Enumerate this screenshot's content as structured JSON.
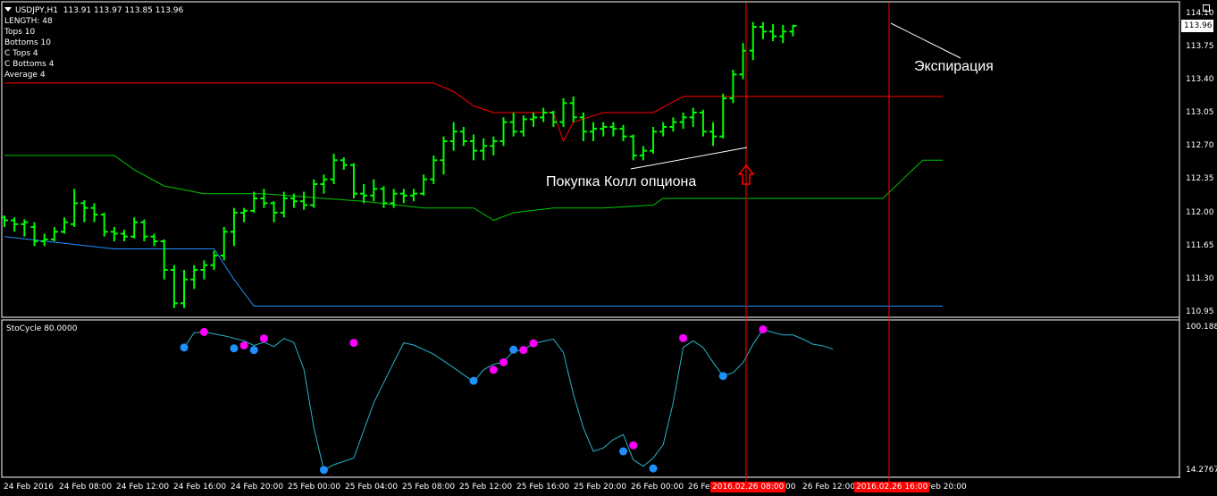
{
  "header": {
    "symbol": "USDJPY,H1",
    "ohlc": "113.91 113.97 113.85 113.96",
    "params": [
      "LENGTH: 48",
      "Tops 10",
      "Bottoms 10",
      "C Tops 4",
      "C Bottoms 4",
      "Average 4"
    ]
  },
  "annotations": {
    "buy": "Покупка Колл опциона",
    "expiry": "Экспирация"
  },
  "oscillator": {
    "label": "StoCycle 80.0000",
    "max_label": "100.1889",
    "min_label": "14.2767"
  },
  "price_axis": {
    "ticks": [
      "114.10",
      "113.75",
      "113.40",
      "113.05",
      "112.70",
      "112.35",
      "112.00",
      "111.65",
      "111.30",
      "110.95"
    ],
    "current": "113.96"
  },
  "time_axis": {
    "ticks": [
      "24 Feb 2016",
      "24 Feb 08:00",
      "24 Feb 12:00",
      "24 Feb 16:00",
      "24 Feb 20:00",
      "25 Feb 00:00",
      "25 Feb 04:00",
      "25 Feb 08:00",
      "25 Feb 12:00",
      "25 Feb 16:00",
      "25 Feb 20:00",
      "26 Feb 00:00",
      "26 Feb",
      ":00",
      "26 Feb 12:00",
      "Feb 20:00"
    ],
    "marker1": "2016.02.26 08:00",
    "marker2": "2016.02.26 16:00"
  },
  "colors": {
    "background": "#000000",
    "bars": "#00ff00",
    "top_line": "#ff0000",
    "mid_line": "#00c800",
    "bottom_line": "#1e90ff",
    "osc_line": "#28b4c8",
    "peak": "#ff00ff",
    "trough": "#1e90ff",
    "vline": "#ff0000",
    "arrow": "#ff0000"
  },
  "chart_data": {
    "type": "line",
    "price_range": [
      110.95,
      114.1
    ],
    "bar_count": 66,
    "time_labels": [
      "24 Feb 2016",
      "24 Feb 08:00",
      "24 Feb 12:00",
      "24 Feb 16:00",
      "24 Feb 20:00",
      "25 Feb 00:00",
      "25 Feb 04:00",
      "25 Feb 08:00",
      "25 Feb 12:00",
      "25 Feb 16:00",
      "25 Feb 20:00",
      "26 Feb 00:00",
      "26 Feb 04:00",
      "26 Feb 08:00",
      "26 Feb 12:00",
      "26 Feb 16:00",
      "26 Feb 20:00"
    ],
    "ohlc": [
      [
        111.95,
        111.97,
        111.85,
        111.92
      ],
      [
        111.92,
        111.95,
        111.8,
        111.88
      ],
      [
        111.88,
        111.93,
        111.75,
        111.9
      ],
      [
        111.85,
        111.9,
        111.65,
        111.7
      ],
      [
        111.7,
        111.78,
        111.65,
        111.72
      ],
      [
        111.72,
        111.85,
        111.7,
        111.8
      ],
      [
        111.8,
        111.95,
        111.78,
        111.9
      ],
      [
        111.88,
        112.25,
        111.85,
        112.1
      ],
      [
        112.1,
        112.13,
        111.9,
        112.05
      ],
      [
        112.05,
        112.1,
        111.9,
        111.98
      ],
      [
        111.98,
        112.0,
        111.75,
        111.8
      ],
      [
        111.8,
        111.85,
        111.7,
        111.78
      ],
      [
        111.78,
        111.82,
        111.7,
        111.75
      ],
      [
        111.75,
        111.95,
        111.73,
        111.9
      ],
      [
        111.9,
        111.93,
        111.7,
        111.75
      ],
      [
        111.75,
        111.78,
        111.65,
        111.7
      ],
      [
        111.7,
        111.72,
        111.3,
        111.4
      ],
      [
        111.4,
        111.45,
        111.0,
        111.05
      ],
      [
        111.05,
        111.4,
        111.0,
        111.3
      ],
      [
        111.3,
        111.45,
        111.2,
        111.4
      ],
      [
        111.4,
        111.5,
        111.3,
        111.45
      ],
      [
        111.45,
        111.6,
        111.4,
        111.55
      ],
      [
        111.55,
        111.85,
        111.5,
        111.8
      ],
      [
        111.8,
        112.05,
        111.65,
        112.0
      ],
      [
        112.0,
        112.05,
        111.9,
        112.02
      ],
      [
        112.02,
        112.22,
        112.0,
        112.15
      ],
      [
        112.15,
        112.25,
        112.05,
        112.1
      ],
      [
        112.1,
        112.12,
        111.9,
        112.0
      ],
      [
        112.0,
        112.22,
        111.95,
        112.15
      ],
      [
        112.15,
        112.2,
        112.05,
        112.12
      ],
      [
        112.12,
        112.22,
        112.03,
        112.08
      ],
      [
        112.08,
        112.35,
        112.05,
        112.3
      ],
      [
        112.3,
        112.4,
        112.2,
        112.35
      ],
      [
        112.35,
        112.62,
        112.3,
        112.55
      ],
      [
        112.55,
        112.58,
        112.45,
        112.5
      ],
      [
        112.5,
        112.52,
        112.15,
        112.2
      ],
      [
        112.2,
        112.3,
        112.1,
        112.18
      ],
      [
        112.18,
        112.35,
        112.12,
        112.25
      ],
      [
        112.25,
        112.28,
        112.05,
        112.1
      ],
      [
        112.1,
        112.25,
        112.05,
        112.2
      ],
      [
        112.2,
        112.25,
        112.1,
        112.18
      ],
      [
        112.18,
        112.25,
        112.12,
        112.2
      ],
      [
        112.2,
        112.4,
        112.18,
        112.35
      ],
      [
        112.35,
        112.6,
        112.3,
        112.55
      ],
      [
        112.55,
        112.8,
        112.4,
        112.75
      ],
      [
        112.75,
        112.95,
        112.65,
        112.85
      ],
      [
        112.85,
        112.9,
        112.7,
        112.75
      ],
      [
        112.75,
        112.82,
        112.55,
        112.65
      ],
      [
        112.65,
        112.78,
        112.55,
        112.7
      ],
      [
        112.7,
        112.8,
        112.6,
        112.75
      ],
      [
        112.75,
        113.0,
        112.7,
        112.95
      ],
      [
        112.95,
        113.05,
        112.8,
        112.85
      ],
      [
        112.85,
        113.02,
        112.8,
        112.98
      ],
      [
        112.98,
        113.05,
        112.9,
        113.0
      ],
      [
        113.0,
        113.1,
        112.95,
        113.05
      ],
      [
        113.05,
        113.07,
        112.9,
        112.95
      ],
      [
        112.95,
        113.2,
        112.9,
        113.15
      ],
      [
        113.15,
        113.22,
        112.95,
        113.0
      ],
      [
        113.0,
        113.05,
        112.75,
        112.85
      ],
      [
        112.85,
        112.95,
        112.75,
        112.88
      ],
      [
        112.88,
        112.95,
        112.8,
        112.9
      ],
      [
        112.9,
        112.95,
        112.8,
        112.88
      ],
      [
        112.88,
        112.92,
        112.75,
        112.8
      ],
      [
        112.8,
        112.82,
        112.55,
        112.6
      ],
      [
        112.6,
        112.7,
        112.55,
        112.65
      ],
      [
        112.65,
        112.9,
        112.62,
        112.85
      ]
    ],
    "tail_ohlc": [
      [
        112.85,
        112.95,
        112.8,
        112.9
      ],
      [
        112.9,
        113.0,
        112.85,
        112.95
      ],
      [
        112.95,
        113.05,
        112.88,
        113.0
      ],
      [
        113.0,
        113.1,
        112.9,
        113.05
      ],
      [
        113.05,
        113.08,
        112.8,
        112.85
      ],
      [
        112.85,
        112.95,
        112.7,
        112.8
      ],
      [
        112.8,
        113.25,
        112.78,
        113.2
      ],
      [
        113.2,
        113.5,
        113.15,
        113.45
      ],
      [
        113.45,
        113.78,
        113.4,
        113.7
      ],
      [
        113.7,
        114.0,
        113.6,
        113.95
      ],
      [
        113.95,
        114.0,
        113.82,
        113.9
      ],
      [
        113.9,
        113.98,
        113.8,
        113.85
      ],
      [
        113.85,
        113.97,
        113.78,
        113.9
      ],
      [
        113.9,
        113.97,
        113.85,
        113.96
      ]
    ],
    "top_line": [
      113.36,
      113.36,
      113.36,
      113.36,
      113.36,
      113.36,
      113.36,
      113.36,
      113.36,
      113.36,
      113.36,
      113.36,
      113.36,
      113.36,
      113.36,
      113.36,
      113.36,
      113.36,
      113.36,
      113.36,
      113.36,
      113.36,
      113.36,
      113.36,
      113.36,
      113.36,
      113.36,
      113.36,
      113.36,
      113.36,
      113.36,
      113.36,
      113.36,
      113.36,
      113.36,
      113.36,
      113.36,
      113.36,
      113.36,
      113.36,
      113.36,
      113.36,
      113.36,
      113.36,
      113.27,
      113.2,
      113.12,
      113.08,
      113.05,
      113.05,
      113.05,
      113.05,
      113.05,
      113.05,
      113.05,
      112.75,
      112.95,
      112.98,
      113.0,
      113.05,
      113.05,
      113.05,
      113.05,
      113.05,
      113.05,
      113.05,
      113.05,
      113.22,
      113.22,
      113.22,
      113.22,
      113.22,
      113.22,
      113.22,
      113.22,
      113.22,
      113.22,
      113.22,
      113.22,
      113.22,
      113.22,
      113.22,
      113.22,
      113.22,
      113.22,
      113.22,
      113.22,
      113.22,
      113.22,
      113.22,
      113.22,
      113.22,
      113.22,
      113.22,
      113.22,
      113.22,
      113.22,
      113.22,
      113.22,
      113.22,
      113.22,
      113.22,
      113.22,
      113.22,
      113.22,
      113.22,
      113.22,
      113.22,
      113.22,
      113.22,
      113.22,
      113.22,
      113.22,
      113.22,
      113.22,
      113.22,
      113.22,
      113.22,
      113.22,
      113.22,
      113.22,
      113.22,
      113.22,
      113.22,
      113.22,
      113.22,
      113.22,
      113.22,
      113.22,
      113.22,
      113.22,
      113.22,
      113.22,
      113.22,
      113.22,
      113.22,
      113.22,
      113.22,
      113.22,
      113.22,
      113.22,
      113.22,
      113.22,
      113.22,
      113.22,
      113.22,
      113.22,
      113.22,
      113.22,
      113.22,
      113.22,
      113.22,
      113.22,
      113.22,
      113.22,
      113.22,
      113.22,
      113.22,
      113.22,
      113.22,
      113.22,
      113.22,
      113.22,
      113.22,
      113.22,
      113.22,
      113.22,
      113.22,
      113.22,
      113.22,
      113.22,
      113.22,
      113.22,
      113.22,
      113.22,
      113.22,
      113.22,
      113.22,
      113.22,
      113.22,
      113.22,
      113.22,
      113.22,
      113.22,
      113.22,
      113.22,
      113.22,
      113.22,
      113.22,
      113.22,
      113.22,
      113.22,
      113.22,
      113.22,
      113.22,
      113.22,
      113.22,
      113.22,
      113.22,
      113.22,
      113.22,
      113.22,
      113.22,
      113.22,
      113.22,
      113.22,
      113.22,
      113.22,
      113.22
    ],
    "top_line_points": [
      [
        0,
        113.36
      ],
      [
        43,
        113.36
      ],
      [
        45,
        113.27
      ],
      [
        47,
        113.12
      ],
      [
        49,
        113.05
      ],
      [
        55,
        113.05
      ],
      [
        56,
        112.75
      ],
      [
        57,
        112.95
      ],
      [
        60,
        113.05
      ],
      [
        63,
        113.05
      ],
      [
        65,
        113.05
      ],
      [
        68,
        113.22
      ],
      [
        79,
        113.22
      ],
      [
        80,
        113.22
      ],
      [
        85,
        113.22
      ],
      [
        88,
        113.22
      ],
      [
        89,
        113.22
      ],
      [
        90,
        113.22
      ],
      [
        91,
        113.22
      ],
      [
        92,
        113.22
      ],
      [
        93,
        113.22
      ],
      [
        94,
        113.22
      ]
    ],
    "mid_line_points": [
      [
        0,
        112.6
      ],
      [
        11,
        112.6
      ],
      [
        13,
        112.45
      ],
      [
        16,
        112.28
      ],
      [
        20,
        112.2
      ],
      [
        26,
        112.2
      ],
      [
        32,
        112.15
      ],
      [
        36,
        112.12
      ],
      [
        42,
        112.05
      ],
      [
        45,
        112.05
      ],
      [
        47,
        112.05
      ],
      [
        49,
        111.92
      ],
      [
        51,
        112.0
      ],
      [
        55,
        112.05
      ],
      [
        60,
        112.05
      ],
      [
        65,
        112.08
      ],
      [
        66,
        112.15
      ],
      [
        68,
        112.15
      ],
      [
        79,
        112.15
      ],
      [
        85,
        112.15
      ],
      [
        88,
        112.15
      ],
      [
        90,
        112.35
      ],
      [
        92,
        112.55
      ],
      [
        94,
        112.55
      ]
    ],
    "bottom_line_points": [
      [
        0,
        111.75
      ],
      [
        11,
        111.62
      ],
      [
        16,
        111.62
      ],
      [
        21,
        111.62
      ],
      [
        23,
        111.3
      ],
      [
        25,
        111.02
      ],
      [
        94,
        111.02
      ]
    ],
    "osc_range": [
      14.2767,
      100.1889
    ],
    "osc_points": [
      [
        18,
        88.0
      ],
      [
        19,
        96.8
      ],
      [
        20,
        97.3
      ],
      [
        22,
        95.0
      ],
      [
        24,
        92.0
      ],
      [
        25,
        89.2
      ],
      [
        26,
        91.2
      ],
      [
        27,
        88.5
      ],
      [
        28,
        93.4
      ],
      [
        29,
        91.0
      ],
      [
        30,
        75.0
      ],
      [
        31,
        40.0
      ],
      [
        32,
        14.9
      ],
      [
        33,
        18.0
      ],
      [
        35,
        22.0
      ],
      [
        37,
        55.0
      ],
      [
        39,
        79.0
      ],
      [
        40,
        90.8
      ],
      [
        41,
        89.5
      ],
      [
        43,
        84.0
      ],
      [
        45,
        76.0
      ],
      [
        47,
        67.5
      ],
      [
        48,
        74.7
      ],
      [
        49,
        78.0
      ],
      [
        50,
        79.2
      ],
      [
        51,
        86.0
      ],
      [
        52,
        86.5
      ],
      [
        53,
        90.5
      ],
      [
        55,
        93.0
      ],
      [
        56,
        85.0
      ],
      [
        57,
        60.0
      ],
      [
        58,
        40.0
      ],
      [
        59,
        26.0
      ],
      [
        60,
        28.0
      ],
      [
        61,
        33.0
      ],
      [
        62,
        36.0
      ],
      [
        63,
        21.0
      ],
      [
        64,
        17.1
      ],
      [
        65,
        22.0
      ],
      [
        66,
        30.0
      ],
      [
        67,
        55.0
      ],
      [
        68,
        88.0
      ],
      [
        69,
        92.0
      ],
      [
        70,
        88.0
      ],
      [
        71,
        79.0
      ],
      [
        72,
        71.0
      ],
      [
        73,
        73.0
      ],
      [
        74,
        79.0
      ],
      [
        75,
        90.0
      ],
      [
        76,
        98.8
      ],
      [
        77,
        97.0
      ],
      [
        78,
        95.5
      ],
      [
        79,
        95.5
      ],
      [
        80,
        93.0
      ],
      [
        81,
        90.0
      ],
      [
        82,
        89.0
      ],
      [
        83,
        87.0
      ]
    ],
    "osc_peaks": [
      [
        20,
        97.3
      ],
      [
        24,
        89.2
      ],
      [
        26,
        93.4
      ],
      [
        35,
        90.8
      ],
      [
        49,
        74.7
      ],
      [
        50,
        79.2
      ],
      [
        52,
        86.5
      ],
      [
        53,
        90.5
      ],
      [
        63,
        29.6
      ],
      [
        68,
        93.6
      ],
      [
        76,
        98.8
      ]
    ],
    "osc_troughs": [
      [
        18,
        88.0
      ],
      [
        23,
        87.5
      ],
      [
        25,
        86.5
      ],
      [
        32,
        14.9
      ],
      [
        47,
        68.1
      ],
      [
        51,
        86.7
      ],
      [
        62,
        26.0
      ],
      [
        65,
        15.8
      ],
      [
        72,
        71.0
      ]
    ]
  }
}
